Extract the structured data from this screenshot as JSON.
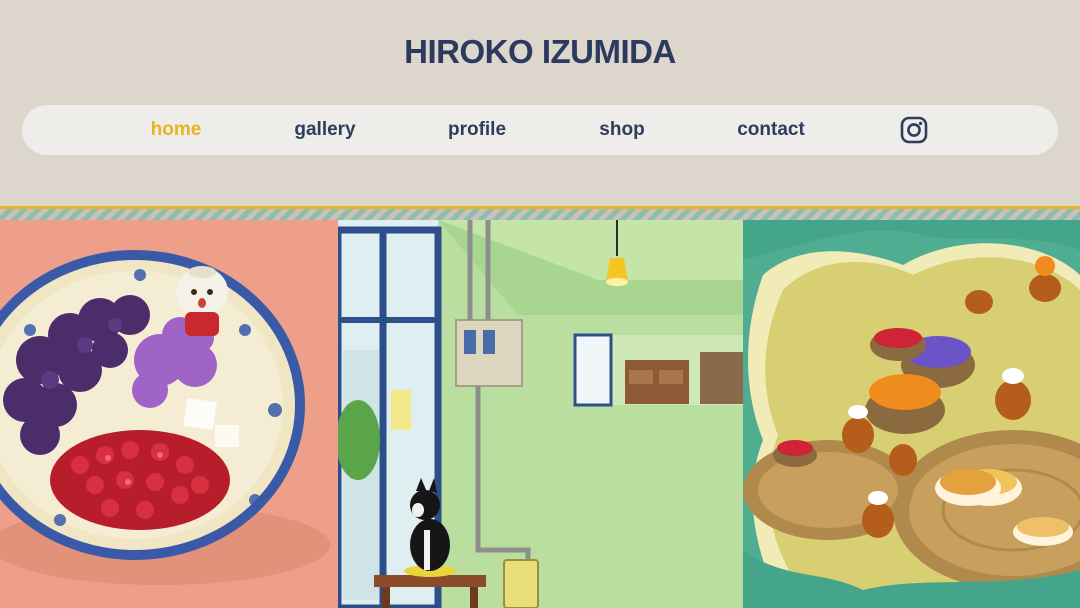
{
  "site": {
    "title": "HIROKO IZUMIDA",
    "title_color": "#2b3a5e",
    "accent_color": "#e6b421"
  },
  "nav": {
    "items": [
      {
        "label": "home",
        "active": true
      },
      {
        "label": "gallery",
        "active": false
      },
      {
        "label": "profile",
        "active": false
      },
      {
        "label": "shop",
        "active": false
      },
      {
        "label": "contact",
        "active": false
      }
    ],
    "instagram_icon": "instagram-icon"
  },
  "gallery": {
    "images": [
      {
        "subject": "shaved ice dessert bowl with bun mascot"
      },
      {
        "subject": "room interior with boston terrier on stool"
      },
      {
        "subject": "squirrels with fruit tarts in forest clearing"
      }
    ]
  }
}
